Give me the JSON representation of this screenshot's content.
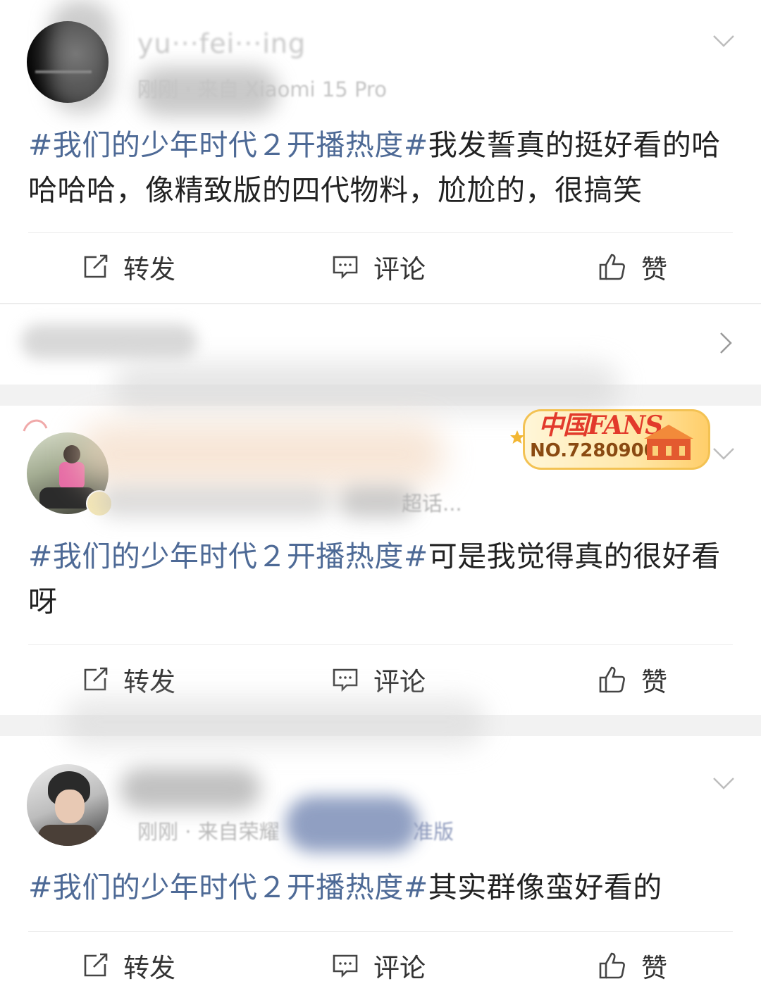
{
  "posts": [
    {
      "username": "yu···fei···ing",
      "meta": "刚刚 · 来自 Xiaomi 15 Pro",
      "hashtag": "#我们的少年时代２开播热度#",
      "body": "我发誓真的挺好看的哈哈哈哈，像精致版的四代物料，尬尬的，很搞笑",
      "icons": [
        "avatar",
        "chevron-down-icon"
      ]
    },
    {
      "username": "",
      "meta": "超话...",
      "badge": {
        "title": "中国FANS",
        "number": "NO.7280900"
      },
      "hashtag": "#我们的少年时代２开播热度#",
      "body": "可是我觉得真的很好看呀",
      "icons": [
        "avatar",
        "verified-badge-icon",
        "chevron-down-icon"
      ]
    },
    {
      "username": "",
      "meta_left": "刚刚 · 来自荣耀",
      "meta_right": "准版",
      "hashtag": "#我们的少年时代２开播热度#",
      "body": "其实群像蛮好看的",
      "icons": [
        "avatar",
        "chevron-down-icon"
      ]
    }
  ],
  "actions": {
    "repost": "转发",
    "comment": "评论",
    "like": "赞"
  },
  "colors": {
    "hashtag": "#4e6a96",
    "text": "#222222",
    "divider": "#ececec",
    "gap": "#f2f2f2"
  }
}
